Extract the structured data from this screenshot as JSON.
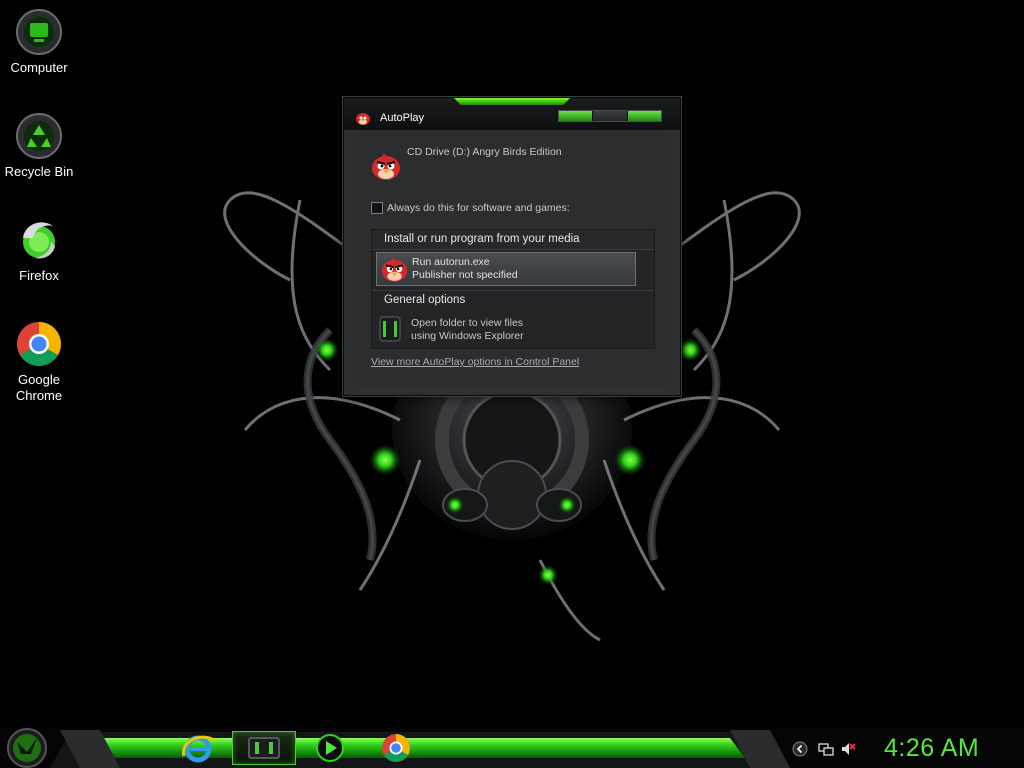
{
  "desktop": {
    "icons": [
      {
        "label": "Computer"
      },
      {
        "label": "Recycle Bin"
      },
      {
        "label": "Firefox"
      },
      {
        "label_line1": "Google",
        "label_line2": "Chrome"
      }
    ]
  },
  "autoplay": {
    "title": "AutoPlay",
    "drive_label": "CD Drive (D:) Angry Birds Edition",
    "always_label": "Always do this for software and games:",
    "always_checked": false,
    "install_header": "Install or run program from your media",
    "run_item": {
      "title": "Run autorun.exe",
      "subtitle": "Publisher not specified"
    },
    "general_header": "General options",
    "folder_item": {
      "line1": "Open folder to view files",
      "line2": "using Windows Explorer"
    },
    "more_link": "View more AutoPlay options in Control Panel"
  },
  "taskbar": {
    "pinned": [
      "internet-explorer-icon",
      "media-window-icon",
      "media-player-icon",
      "chrome-icon"
    ],
    "tray": [
      "chevron-icon",
      "network-icon",
      "volume-muted-icon"
    ],
    "clock": "4:26 AM"
  },
  "colors": {
    "accent": "#57e83a",
    "dialog_bg": "#2d2f31",
    "text": "#c8c8c8"
  }
}
